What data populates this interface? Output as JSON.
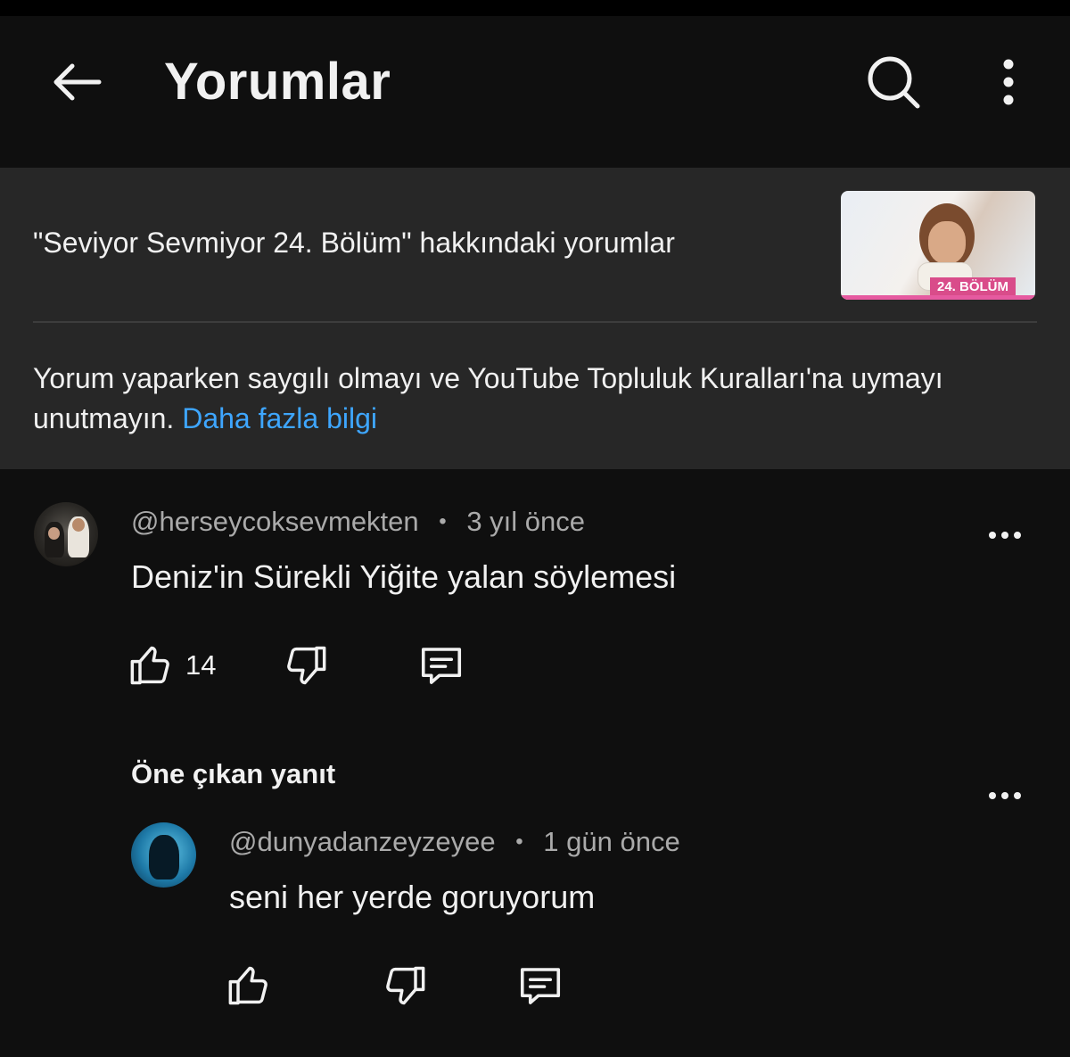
{
  "header": {
    "title": "Yorumlar",
    "back_icon": "arrow-left-icon",
    "search_icon": "search-icon",
    "more_icon": "more-vertical-icon"
  },
  "video": {
    "title": "\"Seviyor Sevmiyor 24. Bölüm\" hakkındaki yorumlar",
    "thumbnail_badge": "24. BÖLÜM"
  },
  "guidelines": {
    "text": "Yorum yaparken saygılı olmayı ve YouTube Topluluk Kuralları'na uymayı unutmayın.",
    "link": "Daha fazla bilgi"
  },
  "comments": [
    {
      "author": "@herseycoksevmekten",
      "separator": "•",
      "time": "3 yıl önce",
      "text": "Deniz'in Sürekli Yiğite yalan söylemesi",
      "likes": "14"
    }
  ],
  "featured_reply": {
    "label": "Öne çıkan yanıt",
    "author": "@dunyadanzeyzeyee",
    "separator": "•",
    "time": "1 gün önce",
    "text": "seni her yerde goruyorum"
  },
  "colors": {
    "background": "#0f0f0f",
    "panel": "#272727",
    "link": "#3ea6ff",
    "secondary_text": "#aaaaaa"
  }
}
